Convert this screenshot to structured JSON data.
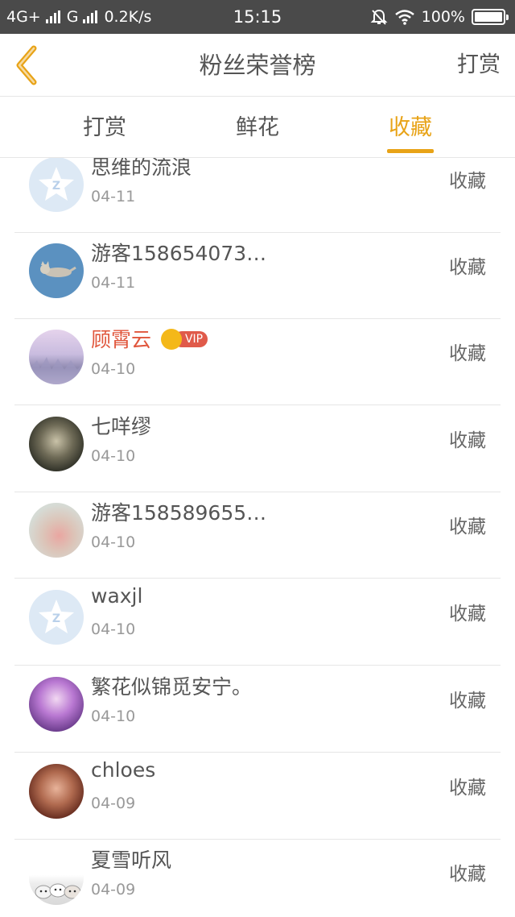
{
  "status_bar": {
    "network_left": "4G+",
    "network_right": "G",
    "speed": "0.2K/s",
    "time": "15:15",
    "battery": "100%",
    "icons": [
      "signal-icon",
      "mute-bell-icon",
      "wifi-icon",
      "battery-icon"
    ]
  },
  "navbar": {
    "title": "粉丝荣誉榜",
    "right_action": "打赏",
    "back_icon": "chevron-left-icon"
  },
  "tabs": [
    {
      "label": "打赏",
      "active": false
    },
    {
      "label": "鲜花",
      "active": false
    },
    {
      "label": "收藏",
      "active": true
    }
  ],
  "accent_color": "#e8a317",
  "fans": [
    {
      "name": "思维的流浪",
      "date": "04-11",
      "action": "收藏",
      "avatar": "qq-default-avatar",
      "vip": false
    },
    {
      "name": "游客158654073…",
      "date": "04-11",
      "action": "收藏",
      "avatar": "cat-avatar",
      "vip": false
    },
    {
      "name": "顾霄云",
      "date": "04-10",
      "action": "收藏",
      "avatar": "winter-landscape-avatar",
      "vip": true,
      "vip_label": "VIP"
    },
    {
      "name": "七咩缪",
      "date": "04-10",
      "action": "收藏",
      "avatar": "girl-photo-avatar",
      "vip": false
    },
    {
      "name": "游客158589655…",
      "date": "04-10",
      "action": "收藏",
      "avatar": "flower-avatar",
      "vip": false
    },
    {
      "name": "waxjl",
      "date": "04-10",
      "action": "收藏",
      "avatar": "qq-default-avatar",
      "vip": false
    },
    {
      "name": "繁花似锦觅安宁。",
      "date": "04-10",
      "action": "收藏",
      "avatar": "anime-girl-avatar",
      "vip": false
    },
    {
      "name": "chloes",
      "date": "04-09",
      "action": "收藏",
      "avatar": "girl-portrait-avatar",
      "vip": false
    },
    {
      "name": "夏雪听风",
      "date": "04-09",
      "action": "收藏",
      "avatar": "cats-avatar",
      "vip": false
    }
  ]
}
